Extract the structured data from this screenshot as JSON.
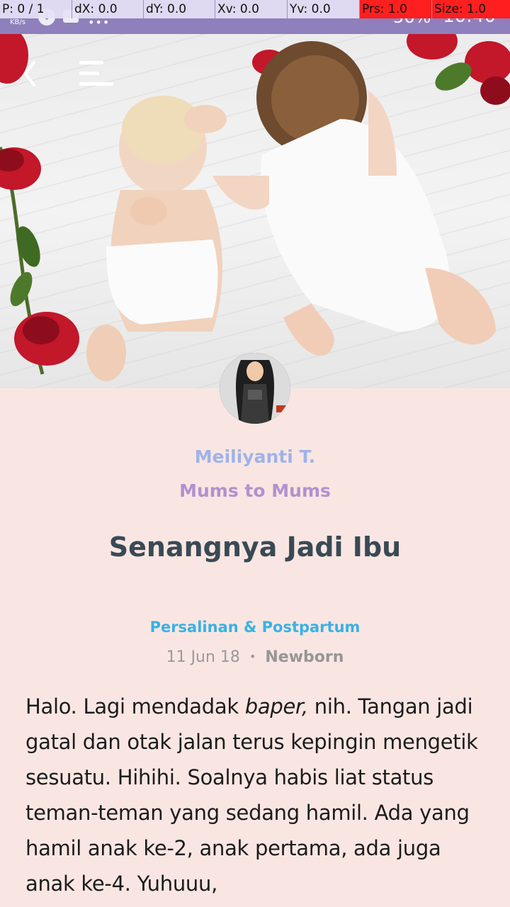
{
  "debug": {
    "pointer": "P: 0 / 1",
    "dx": "dX: 0.0",
    "dy": "dY: 0.0",
    "xv": "Xv: 0.0",
    "yv": "Yv: 0.0",
    "prs": "Prs: 1.0",
    "size": "Size: 1.0"
  },
  "status_bar": {
    "net_speed": "KB/s",
    "battery": "56%",
    "time": "10:40"
  },
  "header": {
    "back_icon": "chevron-left-icon",
    "menu_icon": "menu-icon"
  },
  "author": {
    "name": "Meiliyanti T.",
    "community": "Mums to Mums"
  },
  "post": {
    "title": "Senangnya Jadi Ibu",
    "category": "Persalinan & Postpartum",
    "date": "11 Jun 18",
    "separator": "•",
    "tag": "Newborn",
    "body_part1": "Halo. Lagi mendadak ",
    "body_italic": "baper,",
    "body_part2": " nih. Tangan jadi gatal dan otak jalan terus kepingin mengetik sesuatu. Hihihi. Soalnya habis liat status teman-teman yang sedang hamil.  Ada yang hamil anak ke-2, anak pertama, ada juga anak ke-4. Yuhuuu,"
  },
  "colors": {
    "background": "#f9e6e2",
    "author_name": "#9fb3e8",
    "community": "#b291cf",
    "title": "#394a55",
    "category": "#39b1e4",
    "status_bar": "#8f7fbc"
  }
}
